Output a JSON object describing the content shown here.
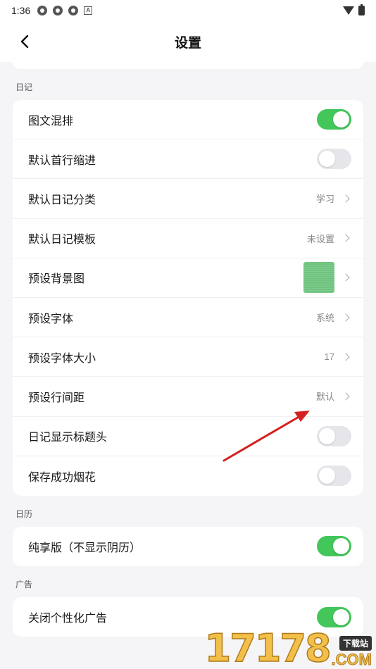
{
  "status_bar": {
    "time": "1:36"
  },
  "header": {
    "title": "设置"
  },
  "sections": [
    {
      "label": "日记",
      "rows": [
        {
          "label": "图文混排",
          "type": "toggle",
          "on": true
        },
        {
          "label": "默认首行缩进",
          "type": "toggle",
          "on": false
        },
        {
          "label": "默认日记分类",
          "type": "value",
          "value": "学习"
        },
        {
          "label": "默认日记模板",
          "type": "value",
          "value": "未设置"
        },
        {
          "label": "预设背景图",
          "type": "image"
        },
        {
          "label": "预设字体",
          "type": "value",
          "value": "系统"
        },
        {
          "label": "预设字体大小",
          "type": "value",
          "value": "17"
        },
        {
          "label": "预设行间距",
          "type": "value",
          "value": "默认"
        },
        {
          "label": "日记显示标题头",
          "type": "toggle",
          "on": false
        },
        {
          "label": "保存成功烟花",
          "type": "toggle",
          "on": false
        }
      ]
    },
    {
      "label": "日历",
      "rows": [
        {
          "label": "纯享版（不显示阴历）",
          "type": "toggle",
          "on": true
        }
      ]
    },
    {
      "label": "广告",
      "rows": [
        {
          "label": "关闭个性化广告",
          "type": "toggle",
          "on": true
        }
      ]
    }
  ],
  "colors": {
    "toggle_on": "#43c65a",
    "toggle_off": "#e6e6ea",
    "annotation_arrow": "#d42020"
  },
  "watermark": {
    "digits": "17178",
    "badge": "下载站",
    "suffix": ".COM"
  }
}
